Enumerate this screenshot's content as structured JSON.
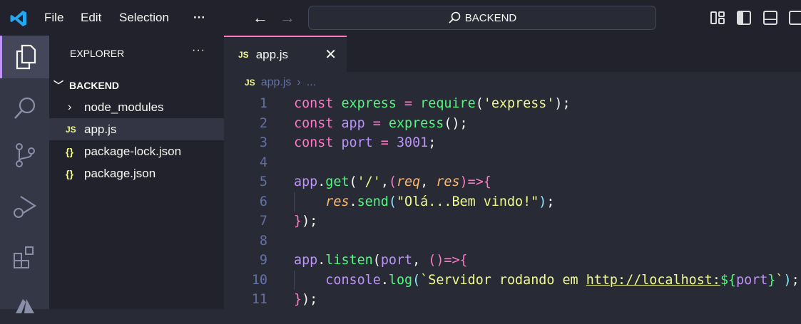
{
  "menu": {
    "items": [
      "File",
      "Edit",
      "Selection"
    ],
    "more": "···"
  },
  "search": {
    "text": "BACKEND"
  },
  "sidebar": {
    "title": "EXPLORER",
    "more": "···",
    "folder": "BACKEND",
    "items": [
      {
        "label": "node_modules",
        "type": "folder"
      },
      {
        "label": "app.js",
        "type": "js",
        "selected": true
      },
      {
        "label": "package-lock.json",
        "type": "json"
      },
      {
        "label": "package.json",
        "type": "json"
      }
    ]
  },
  "tab": {
    "label": "app.js",
    "badge": "JS"
  },
  "breadcrumb": {
    "file": "app.js",
    "rest": "..."
  },
  "colors": {
    "accent": "#ff79c6",
    "editor_bg": "#282a36",
    "sidebar_bg": "#21222c"
  },
  "code": [
    [
      [
        "const ",
        "k"
      ],
      [
        "express",
        "f"
      ],
      [
        " = ",
        "k"
      ],
      [
        "require",
        "f"
      ],
      [
        "(",
        "p"
      ],
      [
        "'express'",
        "s"
      ],
      [
        ");",
        "p"
      ]
    ],
    [
      [
        "const ",
        "k"
      ],
      [
        "app",
        "v"
      ],
      [
        " = ",
        "k"
      ],
      [
        "express",
        "f"
      ],
      [
        "();",
        "p"
      ]
    ],
    [
      [
        "const ",
        "k"
      ],
      [
        "port",
        "v"
      ],
      [
        " = ",
        "k"
      ],
      [
        "3001",
        "v"
      ],
      [
        ";",
        "p"
      ]
    ],
    [],
    [
      [
        "app",
        "v"
      ],
      [
        ".",
        "p"
      ],
      [
        "get",
        "f"
      ],
      [
        "(",
        "p"
      ],
      [
        "'/'",
        "s"
      ],
      [
        ",",
        "p"
      ],
      [
        "(",
        "k"
      ],
      [
        "req",
        "pr"
      ],
      [
        ", ",
        "p"
      ],
      [
        "res",
        "pr"
      ],
      [
        ")=>{",
        "k"
      ]
    ],
    [
      [
        "    ",
        "p"
      ],
      [
        "res",
        "pr"
      ],
      [
        ".",
        "p"
      ],
      [
        "send",
        "f"
      ],
      [
        "(",
        "b"
      ],
      [
        "\"Olá...Bem vindo!\"",
        "s"
      ],
      [
        ")",
        "b"
      ],
      [
        ";",
        "p"
      ]
    ],
    [
      [
        "}",
        "k"
      ],
      [
        ");",
        "p"
      ]
    ],
    [],
    [
      [
        "app",
        "v"
      ],
      [
        ".",
        "p"
      ],
      [
        "listen",
        "f"
      ],
      [
        "(",
        "p"
      ],
      [
        "port",
        "v"
      ],
      [
        ", ",
        "p"
      ],
      [
        "()=>{",
        "k"
      ]
    ],
    [
      [
        "    ",
        "p"
      ],
      [
        "console",
        "v"
      ],
      [
        ".",
        "p"
      ],
      [
        "log",
        "f"
      ],
      [
        "(",
        "b"
      ],
      [
        "`Servidor rodando em ",
        "s"
      ],
      [
        "http://localhost:",
        "u"
      ],
      [
        "${",
        "f"
      ],
      [
        "port",
        "v"
      ],
      [
        "}",
        "f"
      ],
      [
        "`",
        "s"
      ],
      [
        ")",
        "b"
      ],
      [
        ";",
        "p"
      ]
    ],
    [
      [
        "}",
        "k"
      ],
      [
        ");",
        "p"
      ]
    ]
  ]
}
